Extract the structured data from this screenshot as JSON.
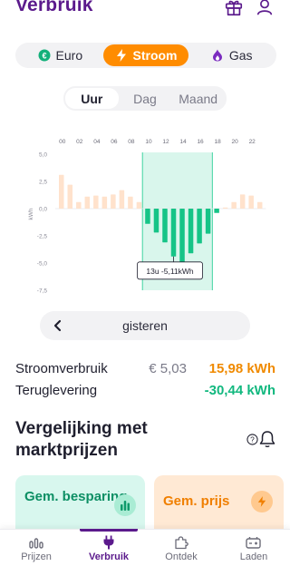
{
  "header": {
    "title": "Verbruik"
  },
  "energy_tabs": [
    {
      "label": "Euro",
      "icon": "euro-icon",
      "active": false
    },
    {
      "label": "Stroom",
      "icon": "lightning-icon",
      "active": true
    },
    {
      "label": "Gas",
      "icon": "flame-icon",
      "active": false
    }
  ],
  "period_tabs": [
    {
      "label": "Uur",
      "active": true
    },
    {
      "label": "Dag",
      "active": false
    },
    {
      "label": "Maand",
      "active": false
    }
  ],
  "chart_data": {
    "type": "bar",
    "ylabel": "kWh",
    "ylim": [
      -7.5,
      5.0
    ],
    "yticks": [
      5.0,
      2.5,
      0.0,
      -2.5,
      -5.0,
      -7.5
    ],
    "ytick_labels": [
      "5,0",
      "2,5",
      "0,0",
      "-2,5",
      "-5,0",
      "-7,5"
    ],
    "xtick_labels": [
      "00",
      "02",
      "04",
      "06",
      "08",
      "10",
      "12",
      "14",
      "16",
      "18",
      "20",
      "22"
    ],
    "x": [
      0,
      1,
      2,
      3,
      4,
      5,
      6,
      7,
      8,
      9,
      10,
      11,
      12,
      13,
      14,
      15,
      16,
      17,
      18,
      19,
      20,
      21,
      22,
      23
    ],
    "values": [
      3.1,
      2.2,
      0.6,
      1.1,
      1.2,
      1.1,
      1.3,
      1.7,
      1.1,
      0.6,
      -1.4,
      -2.2,
      -3.1,
      -4.4,
      -5.11,
      -4.1,
      -3.2,
      -2.3,
      -0.4,
      0.1,
      0.6,
      1.3,
      1.2,
      0.6
    ],
    "past_until_hour": 9,
    "highlight_range": [
      10,
      17
    ],
    "colors": {
      "past": "#ffe2cc",
      "delivery": "#16c487",
      "band": "#d9f6ec",
      "band_line": "#3fd4a1"
    },
    "tooltip": {
      "hour": 13,
      "text": "13u -5,11kWh"
    }
  },
  "day_nav": {
    "label": "gisteren"
  },
  "stats": [
    {
      "label": "Stroomverbruik",
      "euro": "€ 5,03",
      "value": "15,98 kWh",
      "color": "#f08a00"
    },
    {
      "label": "Teruglevering",
      "euro": "",
      "value": "-30,44 kWh",
      "color": "#12b87f"
    }
  ],
  "section": {
    "title": "Vergelijking met marktprijzen",
    "help_glyph": "?"
  },
  "cards": [
    {
      "title": "Gem. besparing",
      "icon": "bar-chart-icon"
    },
    {
      "title": "Gem. prijs",
      "icon": "lightning-icon"
    }
  ],
  "bottom_nav": [
    {
      "label": "Prijzen",
      "icon": "price-bars-icon",
      "active": false
    },
    {
      "label": "Verbruik",
      "icon": "plug-icon",
      "active": true
    },
    {
      "label": "Ontdek",
      "icon": "puzzle-icon",
      "active": false
    },
    {
      "label": "Laden",
      "icon": "battery-icon",
      "active": false
    }
  ]
}
